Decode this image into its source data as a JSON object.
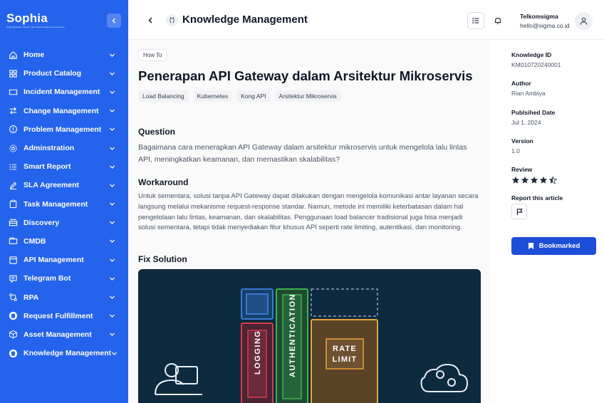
{
  "brand": {
    "name": "Sophia",
    "tagline": "Smart Operation Platform with Hybrid Intelligence Automation"
  },
  "sidebar": {
    "items": [
      {
        "label": "Home",
        "icon": "home-icon"
      },
      {
        "label": "Product Catalog",
        "icon": "grid-icon"
      },
      {
        "label": "Incident Management",
        "icon": "ticket-icon"
      },
      {
        "label": "Change Management",
        "icon": "swap-icon"
      },
      {
        "label": "Problem Management",
        "icon": "alert-circle-icon"
      },
      {
        "label": "Adminstration",
        "icon": "gear-icon"
      },
      {
        "label": "Smart Report",
        "icon": "list-icon"
      },
      {
        "label": "SLA Agreement",
        "icon": "pen-icon"
      },
      {
        "label": "Task Management",
        "icon": "clipboard-icon"
      },
      {
        "label": "Discovery",
        "icon": "drawer-icon"
      },
      {
        "label": "CMDB",
        "icon": "database-icon"
      },
      {
        "label": "API Management",
        "icon": "window-icon"
      },
      {
        "label": "Telegram Bot",
        "icon": "chat-icon"
      },
      {
        "label": "RPA",
        "icon": "flow-icon"
      },
      {
        "label": "Request Fulfillment",
        "icon": "github-icon"
      },
      {
        "label": "Asset Management",
        "icon": "box-icon"
      },
      {
        "label": "Knowledge Management",
        "icon": "github-icon"
      }
    ]
  },
  "header": {
    "title": "Knowledge Management",
    "user_org": "Telkomsigma",
    "user_email": "hello@sigma.co.id"
  },
  "article": {
    "category": "How To",
    "title": "Penerapan API Gateway dalam Arsitektur Mikroservis",
    "tags": [
      "Load Balancing",
      "Kubernetes",
      "Kong API",
      "Arsitektur Mikroservis"
    ],
    "question_heading": "Question",
    "question_body": "Bagaimana cara menerapkan API Gateway dalam arsitektur mikroservis untuk mengelola lalu lintas API, meningkatkan keamanan, dan memastikan skalabilitas?",
    "workaround_heading": "Workaround",
    "workaround_body": "Untuk sementara, solusi tanpa API Gateway dapat dilakukan dengan mengelola komunikasi antar layanan secara langsung melalui mekanisme request-response standar. Namun, metode ini memiliki keterbatasan dalam hal pengelolaan lalu lintas, keamanan, dan skalabilitas. Penggunaan load balancer tradisional juga bisa menjadi solusi sementara, tetapi tidak menyediakan fitur khusus API seperti rate limiting, autentikasi, dan monitoring.",
    "fix_heading": "Fix Solution",
    "diagram": {
      "labels": [
        "LOGGING",
        "AUTHENTICATION",
        "RATE",
        "LIMIT"
      ],
      "colors": {
        "bg": "#0d2a3f",
        "logging": "#d9394b",
        "auth": "#3fb34f",
        "rate": "#e8a23a",
        "blue": "#3a78d6",
        "line": "#e8eef5"
      }
    }
  },
  "details": {
    "knowledge_id_label": "Knowledge ID",
    "knowledge_id": "KM010720240001",
    "author_label": "Author",
    "author": "Rian Ambiya",
    "published_label": "Publsihed Date",
    "published": "Jul 1, 2024",
    "version_label": "Version",
    "version": "1.0",
    "review_label": "Review",
    "review_rating": 4.5,
    "report_label": "Report this article",
    "bookmark_label": "Bookmarked"
  },
  "colors": {
    "sidebar": "#2463eb",
    "primary": "#1d4ed8",
    "text": "#111827"
  }
}
